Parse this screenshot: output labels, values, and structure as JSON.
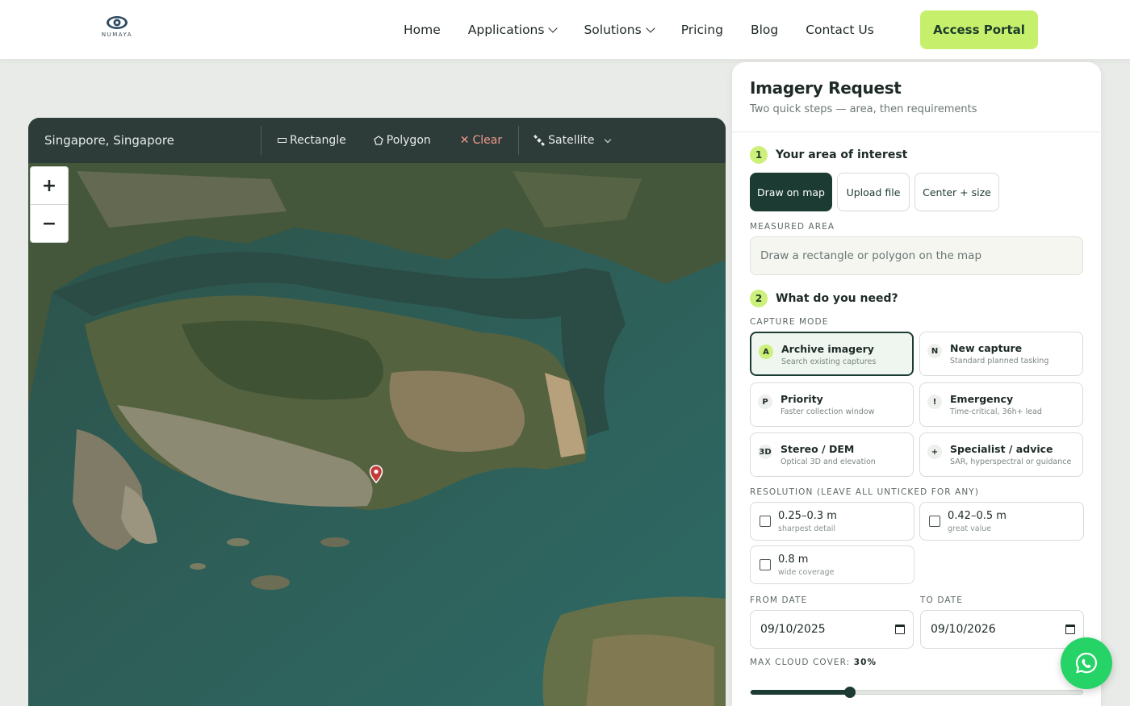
{
  "nav": {
    "logo_text": "NUMAYA",
    "links": [
      {
        "label": "Home",
        "dropdown": false
      },
      {
        "label": "Applications",
        "dropdown": true
      },
      {
        "label": "Solutions",
        "dropdown": true
      },
      {
        "label": "Pricing",
        "dropdown": false
      },
      {
        "label": "Blog",
        "dropdown": false
      },
      {
        "label": "Contact Us",
        "dropdown": false
      }
    ],
    "cta_label": "Access Portal"
  },
  "map": {
    "search_value": "Singapore, Singapore",
    "rectangle_label": "Rectangle",
    "polygon_label": "Polygon",
    "clear_label": "Clear",
    "layer_label": "Satellite",
    "zoom_in": "+",
    "zoom_out": "−"
  },
  "panel": {
    "title": "Imagery Request",
    "subtitle": "Two quick steps — area, then requirements",
    "step1": {
      "num": "1",
      "label": "Your area of interest"
    },
    "area_tabs": [
      "Draw on map",
      "Upload file",
      "Center + size"
    ],
    "measured_area_label": "MEASURED AREA",
    "measured_area_placeholder": "Draw a rectangle or polygon on the map",
    "step2": {
      "num": "2",
      "label": "What do you need?"
    },
    "capture_mode_label": "CAPTURE MODE",
    "capture_modes": [
      {
        "badge": "A",
        "title": "Archive imagery",
        "sub": "Search existing captures",
        "selected": true
      },
      {
        "badge": "N",
        "title": "New capture",
        "sub": "Standard planned tasking",
        "selected": false
      },
      {
        "badge": "P",
        "title": "Priority",
        "sub": "Faster collection window",
        "selected": false
      },
      {
        "badge": "!",
        "title": "Emergency",
        "sub": "Time-critical, 36h+ lead",
        "selected": false
      },
      {
        "badge": "3D",
        "title": "Stereo / DEM",
        "sub": "Optical 3D and elevation",
        "selected": false
      },
      {
        "badge": "+",
        "title": "Specialist / advice",
        "sub": "SAR, hyperspectral or guidance",
        "selected": false
      }
    ],
    "resolution_label": "RESOLUTION (LEAVE ALL UNTICKED FOR ANY)",
    "resolutions": [
      {
        "title": "0.25–0.3 m",
        "sub": "sharpest detail",
        "checked": false
      },
      {
        "title": "0.42–0.5 m",
        "sub": "great value",
        "checked": false
      },
      {
        "title": "0.8 m",
        "sub": "wide coverage",
        "checked": false
      }
    ],
    "from_date_label": "FROM DATE",
    "from_date": "09/10/2025",
    "to_date_label": "TO DATE",
    "to_date": "09/10/2026",
    "cloud_label": "MAX CLOUD COVER:",
    "cloud_value": "30%",
    "cloud_fraction": 0.3
  },
  "colors": {
    "accent_lime": "#c6f06b",
    "dark_green": "#1b3b33",
    "whatsapp": "#25d366",
    "clear_red": "#f09a8b"
  },
  "icons": {
    "whatsapp": "whatsapp-icon",
    "satellite": "satellite-icon",
    "pin": "map-pin-icon"
  }
}
